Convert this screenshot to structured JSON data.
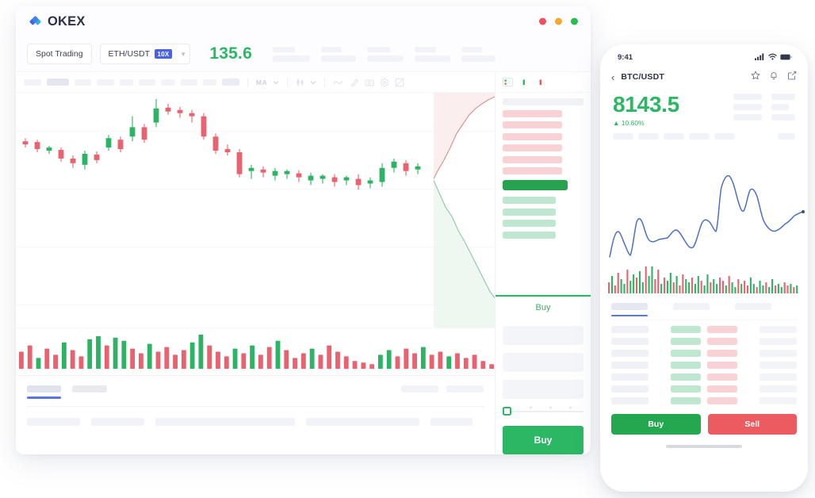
{
  "brand": {
    "name": "OKEX",
    "logo_icon": "okex-diamond-logo"
  },
  "window_controls": {
    "close_label": "close",
    "minimize_label": "minimize",
    "maximize_label": "maximize",
    "colors": {
      "close": "#f34f5e",
      "minimize": "#f6a832",
      "maximize": "#2cbb4f"
    }
  },
  "desktop": {
    "mode_chip": "Spot Trading",
    "pair": "ETH/USDT",
    "leverage_badge": "10X",
    "chevron_icon": "chevron-down-icon",
    "last_price": "135.6",
    "price_color": "#2bb763",
    "header_stats_count": 5,
    "toolbar": {
      "skeleton_count": 10,
      "ma_label": "MA",
      "ma_chevron": "chevron-down-icon",
      "candle_icon": "candlestick-icon",
      "candle_chevron": "chevron-down-icon",
      "icons": [
        "line-chart-icon",
        "drawing-tools-icon",
        "camera-icon",
        "settings-gear-icon",
        "fullscreen-icon"
      ]
    },
    "orderbook": {
      "toggles": [
        "depth-both-icon",
        "depth-bids-icon",
        "depth-asks-icon"
      ],
      "active_toggle_index": 0,
      "ask_bars": 6,
      "bid_bars": 4,
      "mid_bar_color": "#27a34f",
      "ask_color": "#f9d2d5",
      "bid_color": "#bfe7cf"
    },
    "trade_form": {
      "tab_label": "Buy",
      "tab_accent": "#2bb763",
      "field_count": 3,
      "slider_percent": 0,
      "slider_ticks": 3,
      "submit_label": "Buy",
      "submit_color": "#2bb763"
    },
    "bottom_panel": {
      "tab_count": 2,
      "active_tab_index": 0,
      "right_control_count": 2,
      "row_cell_count": 5,
      "accent": "#5a74e8"
    }
  },
  "mobile": {
    "status": {
      "time": "9:41",
      "signal_icon": "cellular-signal-icon",
      "wifi_icon": "wifi-icon",
      "battery_icon": "battery-icon"
    },
    "nav": {
      "back_icon": "back-chevron-icon",
      "pair": "BTC/USDT",
      "icons": [
        "star-favorite-icon",
        "bell-notification-icon",
        "share-icon"
      ]
    },
    "price": "8143.5",
    "change": "▲ 10.60%",
    "price_color": "#2bb763",
    "stat_columns": 2,
    "tag_count": 5,
    "line_chart_color": "#4c6fc4",
    "tabs": {
      "count": 3,
      "active_index": 0,
      "accent": "#5a74e8"
    },
    "book_rows": 7,
    "actions": {
      "buy_label": "Buy",
      "sell_label": "Sell",
      "buy_color": "#24a84f",
      "sell_color": "#ec5b5f"
    },
    "home_indicator": "home-indicator"
  },
  "chart_data": {
    "type": "candlestick",
    "title": "ETH/USDT price chart",
    "xlabel": "",
    "ylabel": "",
    "candles": [
      {
        "o": 62,
        "c": 66,
        "h": 58,
        "l": 70,
        "dir": "down"
      },
      {
        "o": 63,
        "c": 72,
        "h": 60,
        "l": 76,
        "dir": "down"
      },
      {
        "o": 74,
        "c": 70,
        "h": 68,
        "l": 78,
        "dir": "up"
      },
      {
        "o": 73,
        "c": 84,
        "h": 70,
        "l": 88,
        "dir": "down"
      },
      {
        "o": 84,
        "c": 90,
        "h": 80,
        "l": 96,
        "dir": "down"
      },
      {
        "o": 92,
        "c": 78,
        "h": 74,
        "l": 98,
        "dir": "up"
      },
      {
        "o": 79,
        "c": 86,
        "h": 75,
        "l": 90,
        "dir": "down"
      },
      {
        "o": 70,
        "c": 58,
        "h": 54,
        "l": 74,
        "dir": "up"
      },
      {
        "o": 60,
        "c": 72,
        "h": 56,
        "l": 76,
        "dir": "down"
      },
      {
        "o": 56,
        "c": 44,
        "h": 30,
        "l": 62,
        "dir": "up"
      },
      {
        "o": 44,
        "c": 60,
        "h": 40,
        "l": 64,
        "dir": "down"
      },
      {
        "o": 38,
        "c": 20,
        "h": 8,
        "l": 44,
        "dir": "up"
      },
      {
        "o": 19,
        "c": 24,
        "h": 14,
        "l": 28,
        "dir": "down"
      },
      {
        "o": 22,
        "c": 26,
        "h": 18,
        "l": 32,
        "dir": "down"
      },
      {
        "o": 26,
        "c": 30,
        "h": 22,
        "l": 38,
        "dir": "down"
      },
      {
        "o": 30,
        "c": 56,
        "h": 26,
        "l": 60,
        "dir": "down"
      },
      {
        "o": 56,
        "c": 74,
        "h": 52,
        "l": 78,
        "dir": "down"
      },
      {
        "o": 72,
        "c": 76,
        "h": 66,
        "l": 80,
        "dir": "down"
      },
      {
        "o": 76,
        "c": 104,
        "h": 72,
        "l": 108,
        "dir": "down"
      },
      {
        "o": 100,
        "c": 96,
        "h": 92,
        "l": 110,
        "dir": "up"
      },
      {
        "o": 98,
        "c": 102,
        "h": 94,
        "l": 108,
        "dir": "down"
      },
      {
        "o": 100,
        "c": 106,
        "h": 96,
        "l": 112,
        "dir": "up"
      },
      {
        "o": 104,
        "c": 100,
        "h": 98,
        "l": 110,
        "dir": "up"
      },
      {
        "o": 103,
        "c": 108,
        "h": 99,
        "l": 114,
        "dir": "down"
      },
      {
        "o": 106,
        "c": 112,
        "h": 102,
        "l": 118,
        "dir": "up"
      },
      {
        "o": 110,
        "c": 106,
        "h": 104,
        "l": 116,
        "dir": "up"
      },
      {
        "o": 108,
        "c": 114,
        "h": 104,
        "l": 120,
        "dir": "down"
      },
      {
        "o": 112,
        "c": 108,
        "h": 106,
        "l": 118,
        "dir": "up"
      },
      {
        "o": 110,
        "c": 118,
        "h": 104,
        "l": 124,
        "dir": "down"
      },
      {
        "o": 116,
        "c": 112,
        "h": 108,
        "l": 122,
        "dir": "up"
      },
      {
        "o": 114,
        "c": 96,
        "h": 90,
        "l": 120,
        "dir": "up"
      },
      {
        "o": 96,
        "c": 88,
        "h": 84,
        "l": 102,
        "dir": "up"
      },
      {
        "o": 90,
        "c": 100,
        "h": 86,
        "l": 106,
        "dir": "down"
      },
      {
        "o": 98,
        "c": 94,
        "h": 90,
        "l": 104,
        "dir": "up"
      }
    ],
    "volume_bars": 56,
    "depth": {
      "ask_color": "#fbeeee",
      "bid_color": "#eef8f1",
      "ask_line": "#d98b8b",
      "bid_line": "#8cc8a3"
    }
  }
}
